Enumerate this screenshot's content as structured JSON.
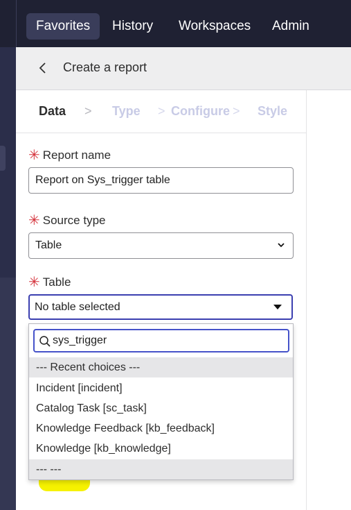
{
  "nav": {
    "tabs": [
      {
        "label": "Favorites",
        "active": true
      },
      {
        "label": "History",
        "active": false
      },
      {
        "label": "Workspaces",
        "active": false
      },
      {
        "label": "Admin",
        "active": false
      }
    ]
  },
  "header": {
    "title": "Create a report",
    "back_icon": "chevron-left-icon"
  },
  "steps": [
    {
      "label": "Data",
      "state": "current"
    },
    {
      "label": "Type",
      "state": "future"
    },
    {
      "label": "Configure",
      "state": "future"
    },
    {
      "label": "Style",
      "state": "future"
    }
  ],
  "form": {
    "required_mark": "✳",
    "report_name": {
      "label": "Report name",
      "value": "Report on Sys_trigger table"
    },
    "source_type": {
      "label": "Source type",
      "value": "Table"
    },
    "table": {
      "label": "Table",
      "value": "No table selected"
    }
  },
  "dropdown": {
    "search_value": "sys_trigger",
    "options": [
      {
        "label": "--- Recent choices ---",
        "kind": "header"
      },
      {
        "label": "Incident [incident]",
        "kind": "option"
      },
      {
        "label": "Catalog Task [sc_task]",
        "kind": "option"
      },
      {
        "label": "Knowledge Feedback [kb_feedback]",
        "kind": "option"
      },
      {
        "label": "Knowledge [kb_knowledge]",
        "kind": "option"
      },
      {
        "label": "--- ---",
        "kind": "header"
      }
    ]
  },
  "colors": {
    "nav_bg": "#1f2133",
    "accent": "#3b3fb0",
    "required": "#d5333c",
    "highlight": "#f6f200"
  }
}
